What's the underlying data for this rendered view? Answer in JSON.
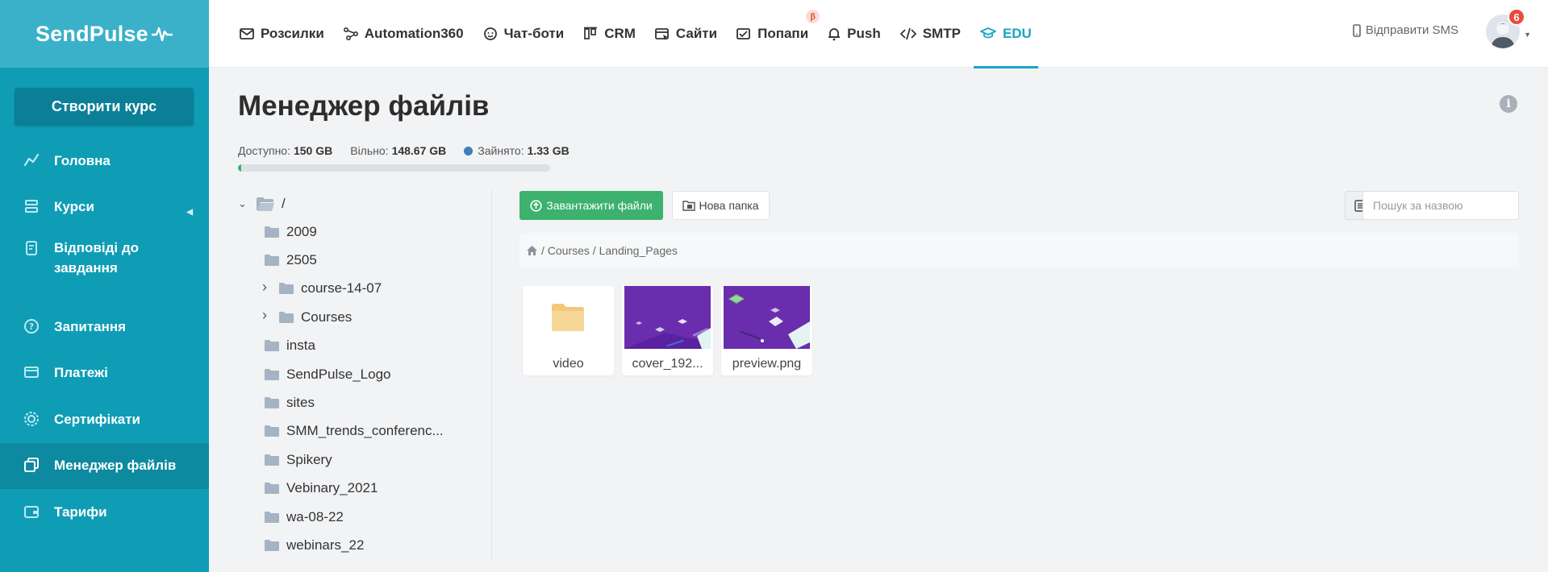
{
  "app": {
    "brand": "SendPulse"
  },
  "sidebar": {
    "create_button": "Створити курс",
    "items": [
      {
        "label": "Головна",
        "icon": "chart-line-icon"
      },
      {
        "label": "Курси",
        "icon": "layers-icon"
      },
      {
        "label": "Відповіді до завдання",
        "icon": "clipboard-icon"
      },
      {
        "label": "Запитання",
        "icon": "question-bubble-icon"
      },
      {
        "label": "Платежі",
        "icon": "payments-icon"
      },
      {
        "label": "Сертифікати",
        "icon": "certificate-gear-icon"
      },
      {
        "label": "Менеджер файлів",
        "icon": "files-icon",
        "active": true
      },
      {
        "label": "Тарифи",
        "icon": "wallet-icon"
      }
    ]
  },
  "topnav": {
    "items": [
      {
        "label": "Розсилки",
        "icon": "mail-icon"
      },
      {
        "label": "Automation360",
        "icon": "automation-icon"
      },
      {
        "label": "Чат-боти",
        "icon": "chatbot-icon"
      },
      {
        "label": "CRM",
        "icon": "crm-icon"
      },
      {
        "label": "Сайти",
        "icon": "site-icon"
      },
      {
        "label": "Попапи",
        "icon": "popup-icon",
        "badge": "β"
      },
      {
        "label": "Push",
        "icon": "bell-icon"
      },
      {
        "label": "SMTP",
        "icon": "code-icon"
      },
      {
        "label": "EDU",
        "icon": "graduation-cap-icon",
        "active": true
      }
    ],
    "sms_label": "Відправити SMS",
    "notification_count": "6"
  },
  "page": {
    "title": "Менеджер файлів",
    "storage": {
      "available_label": "Доступно:",
      "available_value": "150 GB",
      "free_label": "Вільно:",
      "free_value": "148.67 GB",
      "used_label": "Зайнято:",
      "used_value": "1.33 GB",
      "used_fraction": 0.0089
    }
  },
  "tree": {
    "root": "/",
    "folders": [
      {
        "name": "2009",
        "expandable": false
      },
      {
        "name": "2505",
        "expandable": false
      },
      {
        "name": "course-14-07",
        "expandable": true
      },
      {
        "name": "Courses",
        "expandable": true
      },
      {
        "name": "insta",
        "expandable": false
      },
      {
        "name": "SendPulse_Logo",
        "expandable": false
      },
      {
        "name": "sites",
        "expandable": false
      },
      {
        "name": "SMM_trends_conferenc...",
        "expandable": false
      },
      {
        "name": "Spikery",
        "expandable": false
      },
      {
        "name": "Vebinary_2021",
        "expandable": false
      },
      {
        "name": "wa-08-22",
        "expandable": false
      },
      {
        "name": "webinars_22",
        "expandable": false
      }
    ]
  },
  "toolbar": {
    "upload_label": "Завантажити файли",
    "new_folder_label": "Нова папка",
    "search_placeholder": "Пошук за назвою"
  },
  "breadcrumb": {
    "path": "/ Courses / Landing_Pages"
  },
  "files": [
    {
      "name": "video",
      "type": "folder"
    },
    {
      "name": "cover_192...",
      "type": "image"
    },
    {
      "name": "preview.png",
      "type": "image"
    }
  ],
  "colors": {
    "sidebar": "#0f9db6",
    "accent": "#17a7c3",
    "upload": "#3db16e",
    "badge": "#e74c3c",
    "thumb": "#6a2dae"
  }
}
